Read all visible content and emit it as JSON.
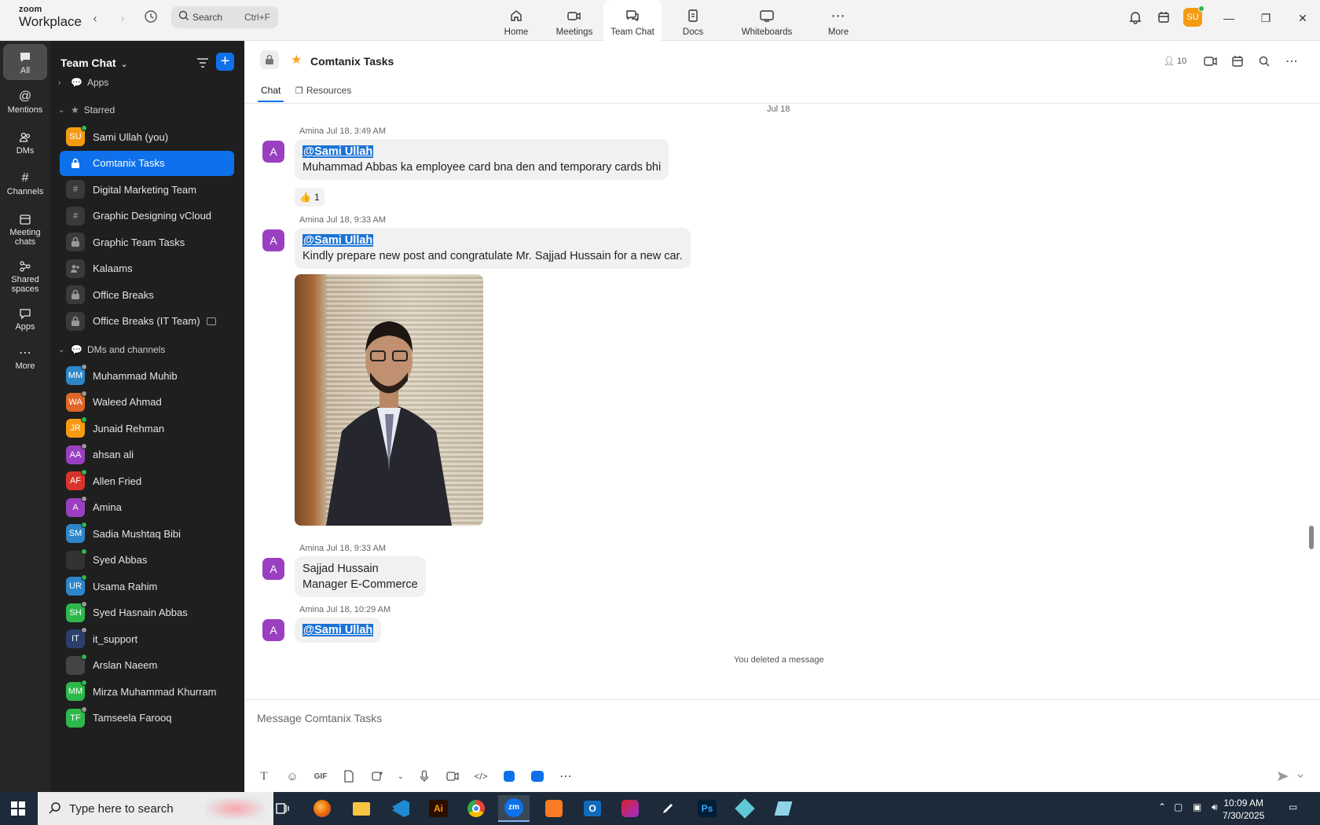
{
  "topbar": {
    "logo_line1": "zoom",
    "logo_line2": "Workplace",
    "search_label": "Search",
    "search_shortcut": "Ctrl+F",
    "tabs": [
      {
        "label": "Home",
        "icon": "home-icon"
      },
      {
        "label": "Meetings",
        "icon": "video-camera-icon"
      },
      {
        "label": "Team Chat",
        "icon": "chat-bubbles-icon"
      },
      {
        "label": "Docs",
        "icon": "document-icon"
      },
      {
        "label": "Whiteboards",
        "icon": "whiteboard-icon"
      },
      {
        "label": "More",
        "icon": "more-dots-icon"
      }
    ],
    "active_tab": "Team Chat",
    "user_initials": "SU"
  },
  "rail": [
    {
      "label": "All",
      "icon": "chat-icon"
    },
    {
      "label": "Mentions",
      "icon": "at-icon"
    },
    {
      "label": "DMs",
      "icon": "people-icon"
    },
    {
      "label": "Channels",
      "icon": "hash-icon"
    },
    {
      "label": "Meeting chats",
      "icon": "calendar-icon"
    },
    {
      "label": "Shared spaces",
      "icon": "shared-spaces-icon"
    },
    {
      "label": "Apps",
      "icon": "apps-icon"
    },
    {
      "label": "More",
      "icon": "more-dots-icon"
    }
  ],
  "sidebar": {
    "title": "Team Chat",
    "apps_label": "Apps",
    "starred_label": "Starred",
    "dms_label": "DMs and channels",
    "starred": [
      {
        "label": "Sami Ullah (you)",
        "initials": "SU",
        "color": "#f59b12",
        "status": "#2db84b"
      },
      {
        "label": "Comtanix Tasks",
        "kind": "lock",
        "selected": true
      },
      {
        "label": "Digital Marketing Team",
        "kind": "hash"
      },
      {
        "label": "Graphic Designing vCloud",
        "kind": "hash"
      },
      {
        "label": "Graphic Team Tasks",
        "kind": "lock"
      },
      {
        "label": "Kalaams",
        "kind": "people"
      },
      {
        "label": "Office Breaks",
        "kind": "lock"
      },
      {
        "label": "Office Breaks (IT Team)",
        "kind": "lock"
      }
    ],
    "dms": [
      {
        "label": "Muhammad Muhib",
        "initials": "MM",
        "color": "#2e86c9",
        "status": "#999"
      },
      {
        "label": "Waleed Ahmad",
        "initials": "WA",
        "color": "#e0662a",
        "status": "#999"
      },
      {
        "label": "Junaid Rehman",
        "initials": "JR",
        "color": "#f59b12",
        "status": "#2db84b"
      },
      {
        "label": "ahsan ali",
        "initials": "AA",
        "color": "#9b3fc1",
        "status": "#999"
      },
      {
        "label": "Allen Fried",
        "initials": "AF",
        "color": "#d9342b",
        "status": "#2db84b"
      },
      {
        "label": "Amina",
        "initials": "A",
        "color": "#9b3fc1",
        "status": "#999"
      },
      {
        "label": "Sadia Mushtaq Bibi",
        "initials": "SM",
        "color": "#2e86c9",
        "status": "#2db84b"
      },
      {
        "label": "Syed Abbas",
        "initials": "",
        "color": "#333",
        "status": "#2db84b"
      },
      {
        "label": "Usama Rahim",
        "initials": "UR",
        "color": "#2e86c9",
        "status": "#2db84b"
      },
      {
        "label": "Syed Hasnain Abbas",
        "initials": "SH",
        "color": "#2db84b",
        "status": "#999"
      },
      {
        "label": "it_support",
        "initials": "IT",
        "color": "#2a3f6b",
        "status": "#999"
      },
      {
        "label": "Arslan Naeem",
        "initials": "",
        "color": "#444",
        "status": "#2db84b"
      },
      {
        "label": "Mirza Muhammad Khurram",
        "initials": "MM",
        "color": "#2db84b",
        "status": "#2db84b"
      },
      {
        "label": "Tamseela Farooq",
        "initials": "TF",
        "color": "#2db84b",
        "status": "#999"
      }
    ]
  },
  "channel": {
    "title": "Comtanix Tasks",
    "member_count": "10",
    "subtabs": [
      "Chat",
      "Resources"
    ],
    "date_separator": "Jul 18",
    "messages": [
      {
        "meta": "Amina  Jul 18, 3:49 AM",
        "avatar": "A",
        "mention": "@Sami Ullah",
        "text": "Muhammad Abbas ka employee card bna den and temporary cards bhi",
        "reaction": "1"
      },
      {
        "meta": "Amina  Jul 18, 9:33 AM",
        "avatar": "A",
        "mention": "@Sami Ullah",
        "text": "Kindly prepare new post and congratulate Mr. Sajjad Hussain for a new car."
      },
      {
        "meta": "Amina  Jul 18, 9:33 AM",
        "avatar": "A",
        "line1": "Sajjad Hussain",
        "line2": "Manager E-Commerce"
      },
      {
        "meta": "Amina  Jul 18, 10:29 AM",
        "avatar": "A",
        "mention": "@Sami Ullah"
      }
    ],
    "deleted_note": "You deleted a message",
    "composer_placeholder": "Message Comtanix Tasks"
  },
  "taskbar": {
    "search_placeholder": "Type here to search",
    "time": "10:09 AM",
    "date": "7/30/2025"
  }
}
